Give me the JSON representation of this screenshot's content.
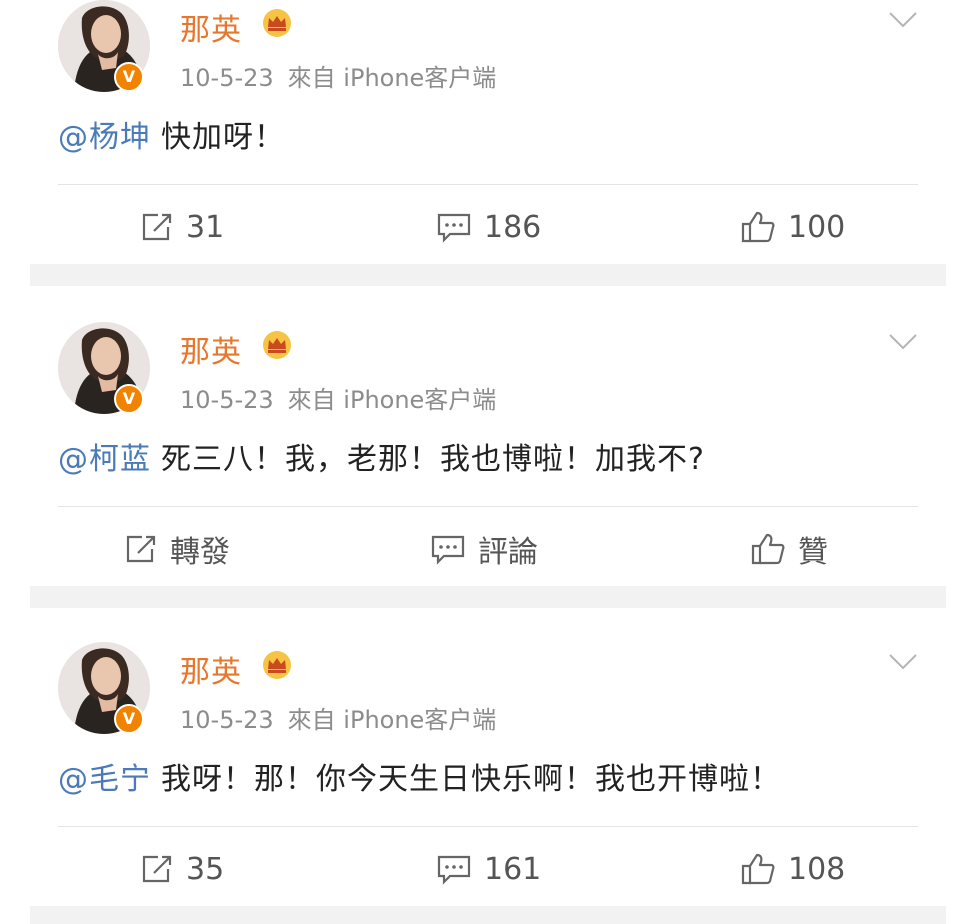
{
  "posts": [
    {
      "author": "那英",
      "date": "10-5-23",
      "source": "來自 iPhone客户端",
      "mention": "@杨坤",
      "text": "快加呀！",
      "repost": "31",
      "comment": "186",
      "like": "100"
    },
    {
      "author": "那英",
      "date": "10-5-23",
      "source": "來自 iPhone客户端",
      "mention": "@柯蓝",
      "text": "死三八！我，老那！我也博啦！加我不?",
      "repost": "轉發",
      "comment": "評論",
      "like": "贊"
    },
    {
      "author": "那英",
      "date": "10-5-23",
      "source": "來自 iPhone客户端",
      "mention": "@毛宁",
      "text": "我呀！那！你今天生日快乐啊！我也开博啦！",
      "repost": "35",
      "comment": "161",
      "like": "108"
    }
  ],
  "badge": {
    "verified": "V"
  },
  "icons": {
    "avatar": "avatar-icon",
    "crown": "crown-icon",
    "chevron": "chevron-down-icon",
    "repost": "repost-icon",
    "comment": "comment-icon",
    "like": "like-icon"
  },
  "colors": {
    "author": "#e8772e",
    "mention": "#4a7ab8",
    "meta": "#8c8c8c",
    "badge": "#f08300",
    "separator": "#f2f2f2"
  }
}
